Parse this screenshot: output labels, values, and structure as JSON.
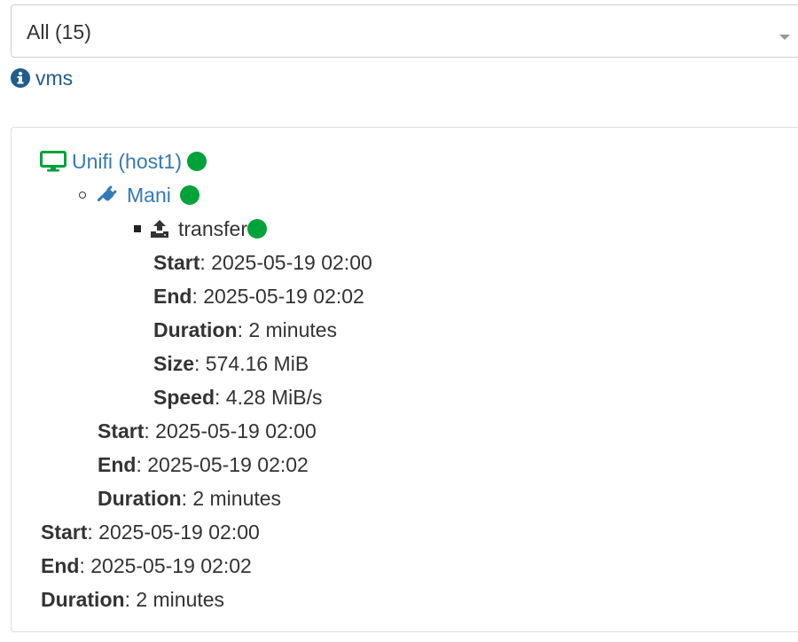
{
  "filter_select": {
    "value": "All (15)"
  },
  "info_link": {
    "icon": "info-circle-icon",
    "label": "vms"
  },
  "tree": {
    "host": {
      "icon": "desktop-icon",
      "label": "Unifi (host1)",
      "status_color": "#00a23a",
      "children": {
        "job": {
          "icon": "plug-icon",
          "label": "Mani",
          "status_color": "#00a23a",
          "task": {
            "icon": "upload-icon",
            "label": "transfer",
            "status_color": "#00a23a",
            "details": [
              {
                "key": "Start",
                "value": ": 2025-05-19 02:00"
              },
              {
                "key": "End",
                "value": ": 2025-05-19 02:02"
              },
              {
                "key": "Duration",
                "value": ": 2 minutes"
              },
              {
                "key": "Size",
                "value": ": 574.16 MiB"
              },
              {
                "key": "Speed",
                "value": ": 4.28 MiB/s"
              }
            ]
          },
          "details": [
            {
              "key": "Start",
              "value": ": 2025-05-19 02:00"
            },
            {
              "key": "End",
              "value": ": 2025-05-19 02:02"
            },
            {
              "key": "Duration",
              "value": ": 2 minutes"
            }
          ]
        }
      },
      "details": [
        {
          "key": "Start",
          "value": ": 2025-05-19 02:00"
        },
        {
          "key": "End",
          "value": ": 2025-05-19 02:02"
        },
        {
          "key": "Duration",
          "value": ": 2 minutes"
        }
      ]
    }
  },
  "colors": {
    "link": "#337ab7",
    "status_ok": "#00a23a",
    "host_icon": "#00a23a",
    "job_icon": "#337ab7"
  }
}
